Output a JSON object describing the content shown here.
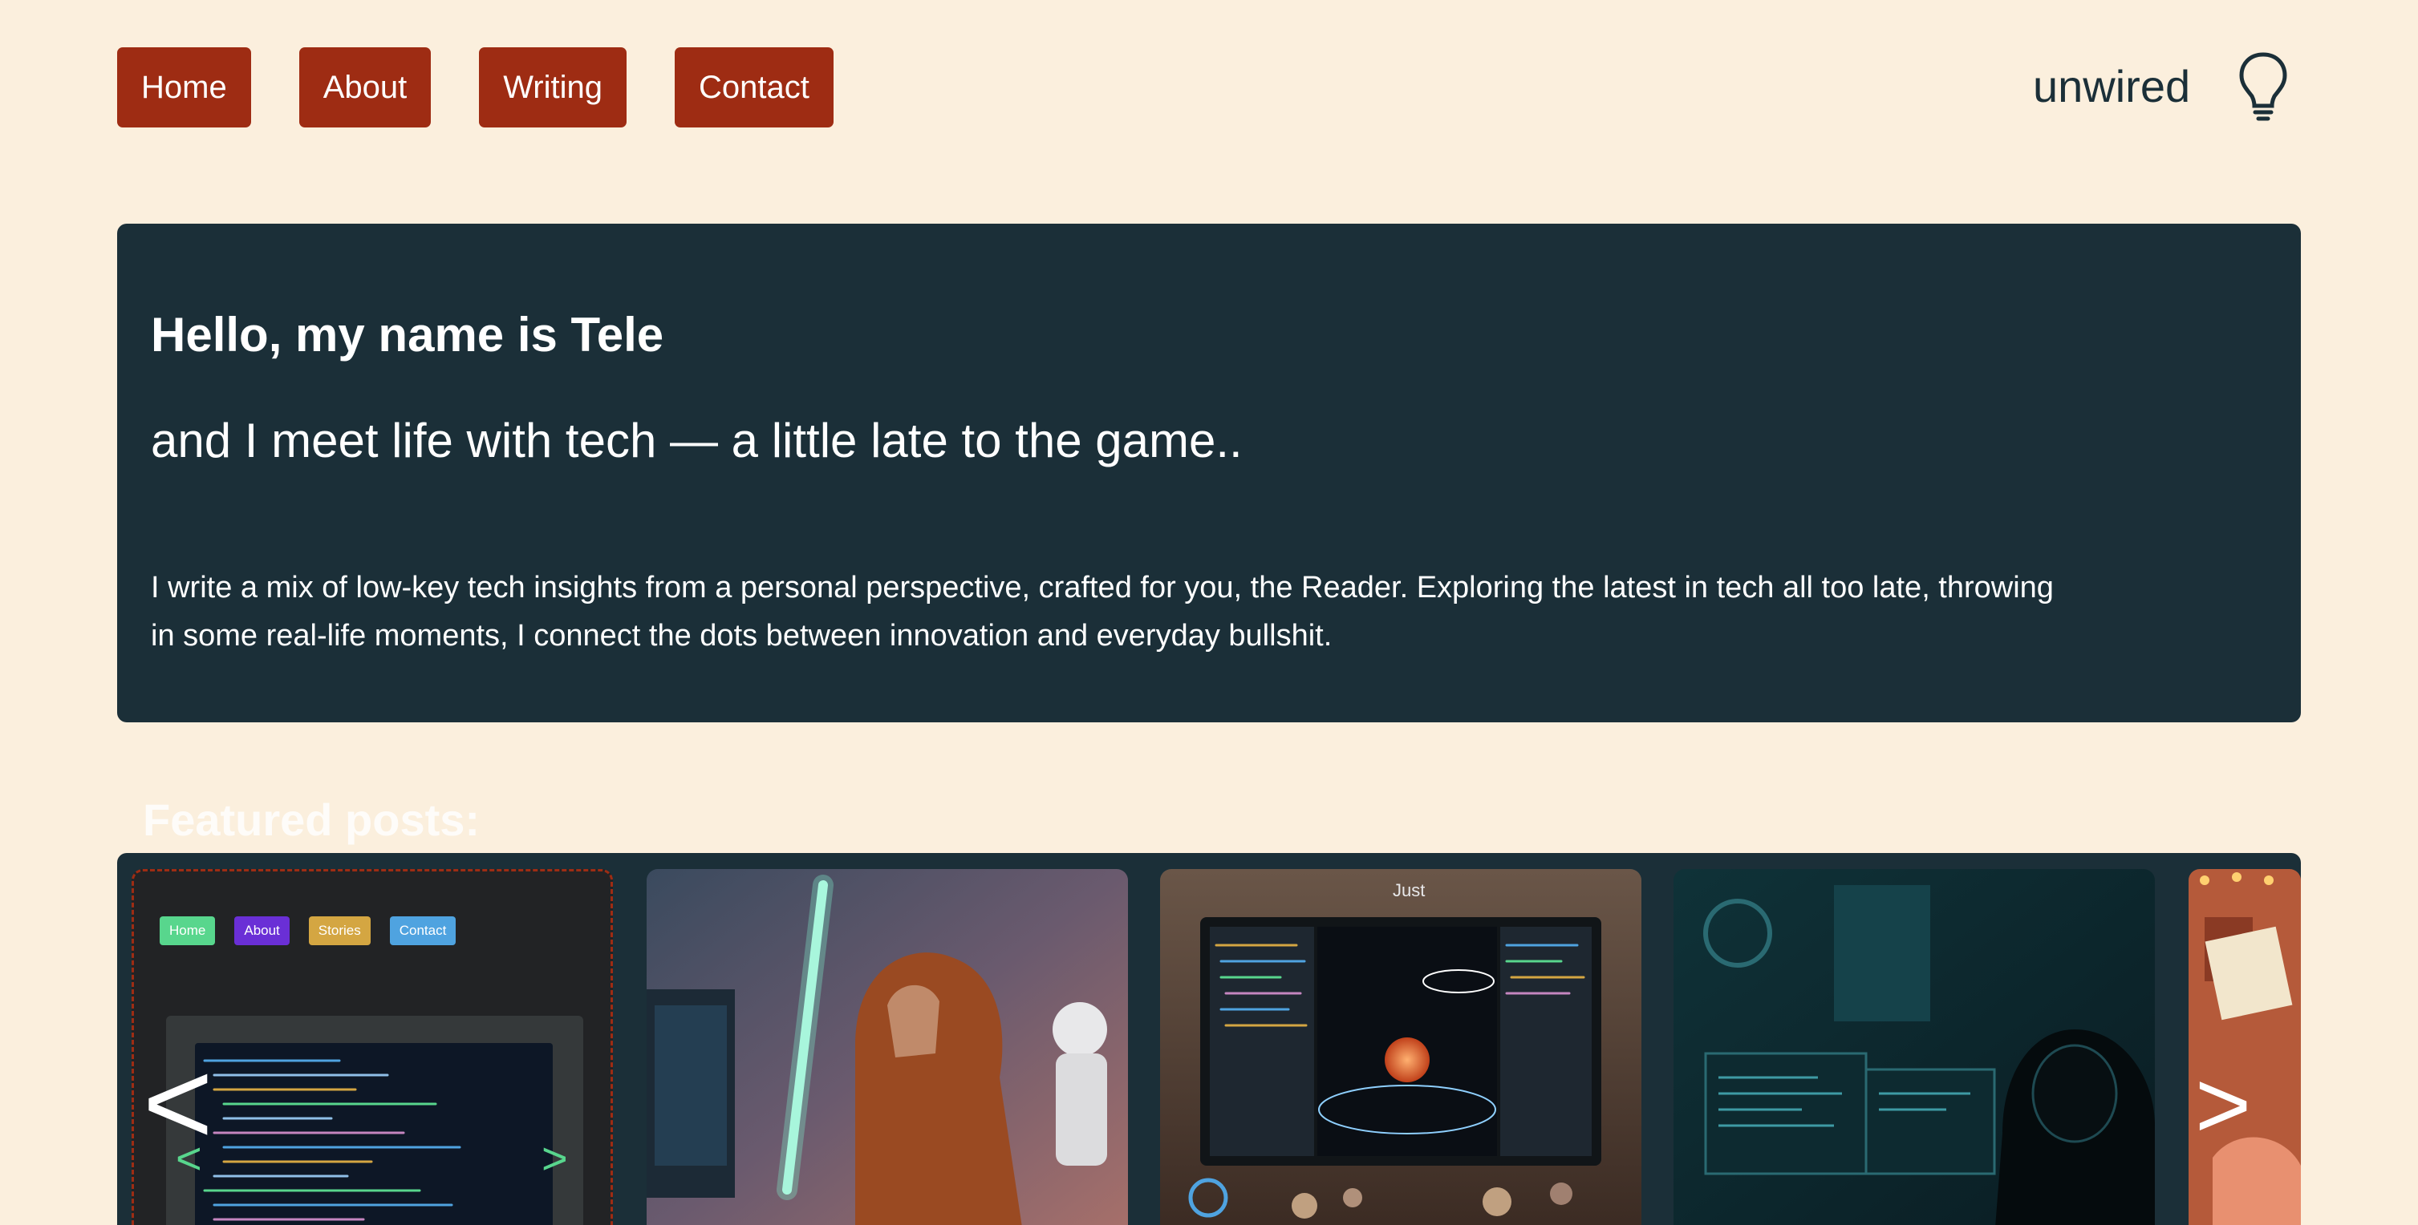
{
  "nav": {
    "items": [
      {
        "label": "Home"
      },
      {
        "label": "About"
      },
      {
        "label": "Writing"
      },
      {
        "label": "Contact"
      }
    ]
  },
  "brand": {
    "name": "unwired",
    "icon": "lightbulb-icon"
  },
  "hero": {
    "heading": "Hello, my name is Tele",
    "subheading": "and I meet life with tech — a little late to the game..",
    "intro": "I write a mix of low-key tech insights from a personal perspective, crafted for you, the Reader. Exploring the latest in tech all too late, throwing in some real-life moments, I connect the dots between innovation and everyday bullshit."
  },
  "featured": {
    "title": "Featured posts:",
    "prev_label": "<",
    "next_label": ">",
    "preview_nav": [
      "Home",
      "About",
      "Stories",
      "Contact"
    ],
    "preview_prev": "<",
    "preview_next": ">",
    "card_overlay_text": "Just"
  },
  "colors": {
    "background": "#fbefdd",
    "nav_button": "#9e2c13",
    "panel": "#1b2f38",
    "text_dark": "#1b2f38"
  }
}
